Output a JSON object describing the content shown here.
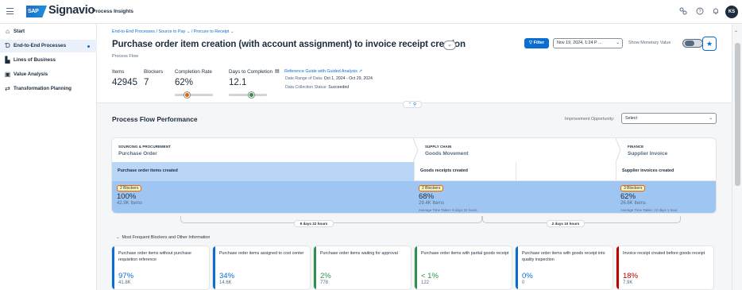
{
  "shell": {
    "logo_badge": "SAP",
    "logo_text": "Signavio",
    "product": "Process Insights",
    "icons": [
      "share-icon",
      "help-icon",
      "notification-icon"
    ],
    "avatar_initials": "KS"
  },
  "sidebar": {
    "items": [
      {
        "label": "Start",
        "icon": "home-icon"
      },
      {
        "label": "End-to-End Processes",
        "icon": "e2e-process-icon",
        "active": true
      },
      {
        "label": "Lines of Business",
        "icon": "building-icon"
      },
      {
        "label": "Value Analysis",
        "icon": "money-bills-icon"
      },
      {
        "label": "Transformation Planning",
        "icon": "transformation-icon"
      }
    ]
  },
  "header": {
    "breadcrumb": [
      "End-to-End Processes",
      "Source to Pay",
      "Procure to Receipt"
    ],
    "title": "Purchase order item creation (with account assignment) to invoice receipt creation",
    "subtitle": "Process Flow",
    "filter_label": "Filter",
    "date_value": "Nov 19, 2024, 1:24 P ...",
    "monetary_label": "Show Monetary Value",
    "monetary_on": false,
    "kpis": [
      {
        "label": "Items",
        "value": "42945"
      },
      {
        "label": "Blockers",
        "value": "7"
      },
      {
        "label": "Completion Rate",
        "value": "62%",
        "slider_level": 0.32,
        "slider_color": "#e76500"
      },
      {
        "label": "Days to Completion",
        "value": "12.1",
        "slider_level": 0.6,
        "slider_color": "#30914c"
      }
    ],
    "guide_link": "Reference Guide with Guided Analysis",
    "date_range_label": "Date Range of Data:",
    "date_range_value": "Oct 1, 2024 - Oct 29, 2024",
    "collection_label": "Data Collection Status:",
    "collection_value": "Succeeded"
  },
  "flow": {
    "section_title": "Process Flow Performance",
    "improvement_label": "Improvement Opportunity:",
    "improvement_value": "Select",
    "categories": [
      {
        "area": "SOURCING & PROCUREMENT",
        "name": "Purchase Order"
      },
      {
        "area": "SUPPLY CHAIN",
        "name": "Goods Movement"
      },
      {
        "area": "FINANCE",
        "name": "Supplier Invoice"
      }
    ],
    "steps": [
      {
        "name": "Purchase order items created",
        "blockers": "2 Blockers",
        "pct": "100%",
        "items": "42.9K Items",
        "avg": ""
      },
      {
        "name": "Goods receipts created",
        "blockers": "2 Blockers",
        "pct": "68%",
        "items": "29.4K Items",
        "avg": "Average Time Taken: 9 days 22 hours"
      },
      {
        "name": "Supplier invoices created",
        "blockers": "3 Blockers",
        "pct": "62%",
        "items": "26.6K Items",
        "avg": "Average Time Taken: 12 days 1 hour"
      }
    ],
    "durations": [
      "9 days 22 hours",
      "2 days 10 hours"
    ],
    "more_label": "Most Frequent Blockers and Other Information",
    "cards": [
      {
        "text": "Purchase order items without purchase requisition reference",
        "pct": "97%",
        "count": "41.8K",
        "color": "#0a6ed1"
      },
      {
        "text": "Purchase order items assigned to cost center",
        "pct": "34%",
        "count": "14.6K",
        "color": "#0a6ed1"
      },
      {
        "text": "Purchase order items waiting for approval",
        "pct": "2%",
        "count": "778",
        "color": "#30914c"
      },
      {
        "text": "Purchase order items with partial goods receipt",
        "pct": "< 1%",
        "count": "122",
        "color": "#30914c"
      },
      {
        "text": "Purchase order items with goods receipt into quality inspection",
        "pct": "0%",
        "count": "0",
        "color": "#0a6ed1"
      },
      {
        "text": "Invoice receipt created before goods receipt",
        "pct": "18%",
        "count": "7.9K",
        "color": "#bb0000"
      }
    ]
  }
}
